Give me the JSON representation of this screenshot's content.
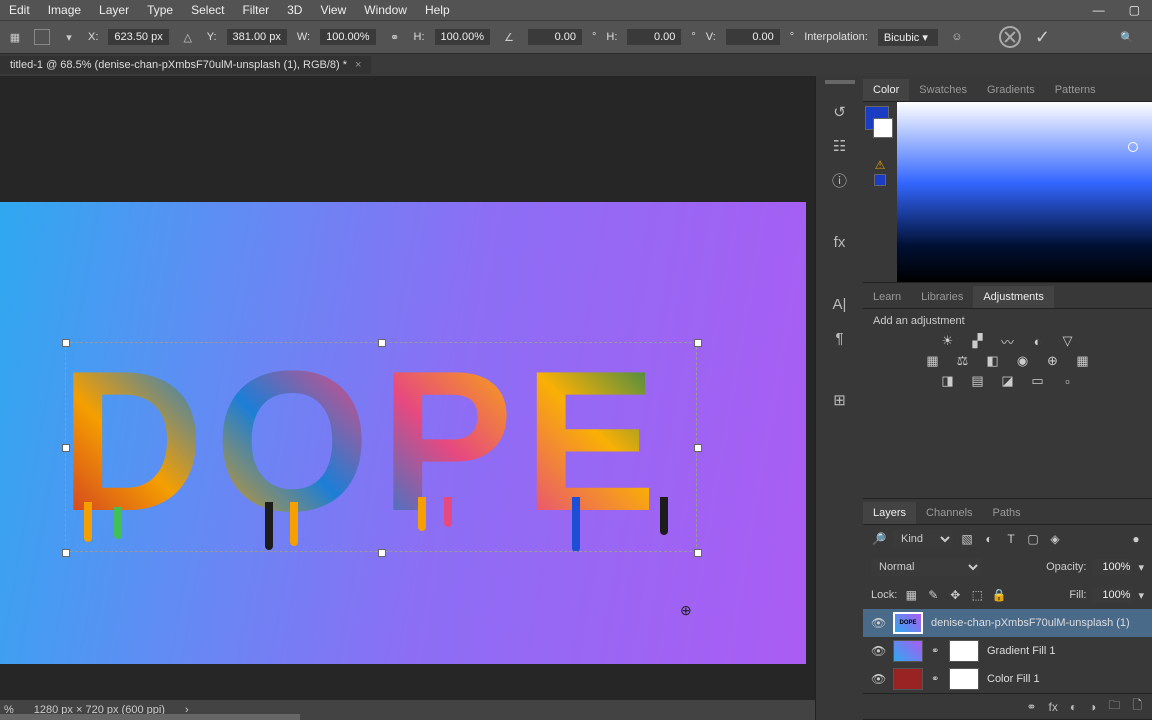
{
  "menu": {
    "items": [
      "Edit",
      "Image",
      "Layer",
      "Type",
      "Select",
      "Filter",
      "3D",
      "View",
      "Window",
      "Help"
    ]
  },
  "options": {
    "x_label": "X:",
    "x": "623.50 px",
    "y_label": "Y:",
    "y": "381.00 px",
    "w_label": "W:",
    "w": "100.00%",
    "h_label": "H:",
    "h": "100.00%",
    "rot": "0.00",
    "skew_h_label": "H:",
    "skew_h": "0.00",
    "skew_v_label": "V:",
    "skew_v": "0.00",
    "interp_label": "Interpolation:",
    "interp": "Bicubic"
  },
  "doctab": {
    "title": "titled-1 @ 68.5% (denise-chan-pXmbsF70ulM-unsplash (1), RGB/8) *",
    "close": "×"
  },
  "color_panel": {
    "tabs": [
      "Color",
      "Swatches",
      "Gradients",
      "Patterns"
    ],
    "active": 0
  },
  "learn_panel": {
    "tabs": [
      "Learn",
      "Libraries",
      "Adjustments"
    ],
    "active": 2,
    "add_label": "Add an adjustment"
  },
  "layers_panel": {
    "tabs": [
      "Layers",
      "Channels",
      "Paths"
    ],
    "active": 0,
    "filter_kind": "Kind",
    "blend": "Normal",
    "opacity_label": "Opacity:",
    "opacity": "100%",
    "lock_label": "Lock:",
    "fill_label": "Fill:",
    "fill": "100%",
    "layers": [
      {
        "name": "denise-chan-pXmbsF70ulM-unsplash (1)",
        "selected": true,
        "thumb": "dope"
      },
      {
        "name": "Gradient Fill 1",
        "selected": false,
        "thumb": "gr"
      },
      {
        "name": "Color Fill 1",
        "selected": false,
        "thumb": "red"
      }
    ]
  },
  "statusbar": {
    "zoom": "%",
    "doc": "1280 px × 720 px (600 ppi)",
    "arrow": "›"
  },
  "canvas": {
    "text": "DOPE"
  }
}
